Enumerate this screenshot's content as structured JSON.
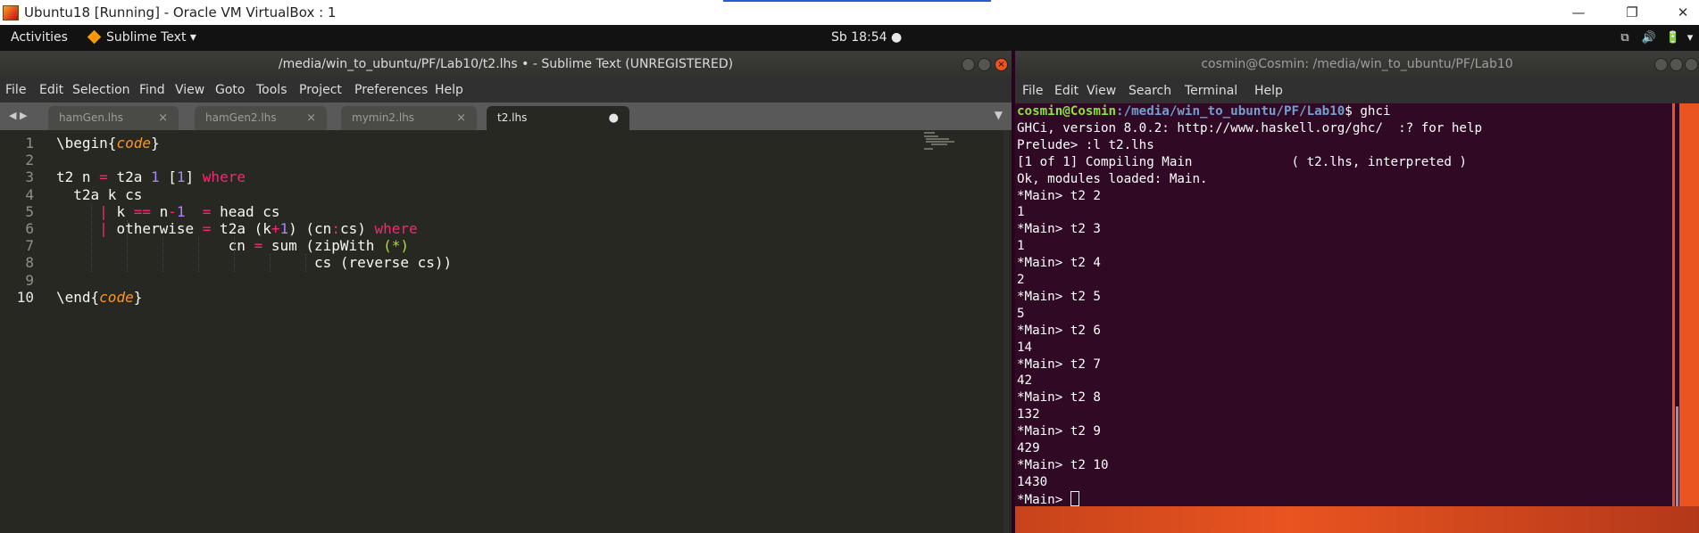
{
  "vm_window": {
    "title": "Ubuntu18 [Running] - Oracle VM VirtualBox : 1",
    "minimize": "—",
    "restore": "❐",
    "close": "✕"
  },
  "topbar": {
    "activities": "Activities",
    "app_name": "Sublime Text",
    "app_caret": "▾",
    "clock": "Sb 18:54 ●",
    "tray": [
      "⧉",
      "🔊",
      "🔋",
      "▾"
    ]
  },
  "sublime": {
    "title": "/media/win_to_ubuntu/PF/Lab10/t2.lhs • - Sublime Text (UNREGISTERED)",
    "menu": [
      "File",
      "Edit",
      "Selection",
      "Find",
      "View",
      "Goto",
      "Tools",
      "Project",
      "Preferences",
      "Help"
    ],
    "tabs": [
      {
        "label": "hamGen.lhs",
        "close": "×"
      },
      {
        "label": "hamGen2.lhs",
        "close": "×"
      },
      {
        "label": "mymin2.lhs",
        "close": "×"
      },
      {
        "label": "t2.lhs",
        "close": "●"
      }
    ],
    "tab_nav": "◀ ▶",
    "tab_dropdown": "▼",
    "line_numbers": [
      "1",
      "2",
      "3",
      "4",
      "5",
      "6",
      "7",
      "8",
      "9",
      "10"
    ],
    "code": [
      [
        {
          "t": "\\begin{",
          "c": ""
        },
        {
          "t": "code",
          "c": "it"
        },
        {
          "t": "}",
          "c": ""
        }
      ],
      [],
      [
        {
          "t": "t2 n ",
          "c": ""
        },
        {
          "t": "=",
          "c": "kw"
        },
        {
          "t": " t2a ",
          "c": ""
        },
        {
          "t": "1",
          "c": "num"
        },
        {
          "t": " [",
          "c": ""
        },
        {
          "t": "1",
          "c": "num"
        },
        {
          "t": "] ",
          "c": ""
        },
        {
          "t": "where",
          "c": "kw"
        }
      ],
      [
        {
          "t": "  t2a k cs",
          "c": ""
        }
      ],
      [
        {
          "t": "     ",
          "c": ""
        },
        {
          "t": "|",
          "c": "kw"
        },
        {
          "t": " k ",
          "c": ""
        },
        {
          "t": "==",
          "c": "kw"
        },
        {
          "t": " n",
          "c": ""
        },
        {
          "t": "-",
          "c": "kw"
        },
        {
          "t": "1",
          "c": "num"
        },
        {
          "t": "  ",
          "c": ""
        },
        {
          "t": "=",
          "c": "kw"
        },
        {
          "t": " head cs",
          "c": ""
        }
      ],
      [
        {
          "t": "     ",
          "c": ""
        },
        {
          "t": "|",
          "c": "kw"
        },
        {
          "t": " otherwise ",
          "c": ""
        },
        {
          "t": "=",
          "c": "kw"
        },
        {
          "t": " t2a (k",
          "c": ""
        },
        {
          "t": "+",
          "c": "kw"
        },
        {
          "t": "1",
          "c": "num"
        },
        {
          "t": ") (cn",
          "c": ""
        },
        {
          "t": ":",
          "c": "kw"
        },
        {
          "t": "cs) ",
          "c": ""
        },
        {
          "t": "where",
          "c": "kw"
        }
      ],
      [
        {
          "t": "                    cn ",
          "c": ""
        },
        {
          "t": "=",
          "c": "kw"
        },
        {
          "t": " sum (zipWith ",
          "c": ""
        },
        {
          "t": "(*)",
          "c": "str"
        }
      ],
      [
        {
          "t": "                              cs (reverse cs))",
          "c": ""
        }
      ],
      [],
      [
        {
          "t": "\\end{",
          "c": ""
        },
        {
          "t": "code",
          "c": "it"
        },
        {
          "t": "}",
          "c": ""
        }
      ]
    ]
  },
  "terminal": {
    "title": "cosmin@Cosmin: /media/win_to_ubuntu/PF/Lab10",
    "menu": [
      "File",
      "Edit",
      "View",
      "Search",
      "Terminal",
      "Help"
    ],
    "prompt_user": "cosmin@Cosmin",
    "prompt_path": ":/media/win_to_ubuntu/PF/Lab10",
    "prompt_cmd": "$ ghci",
    "lines": [
      "GHCi, version 8.0.2: http://www.haskell.org/ghc/  :? for help",
      "Prelude> :l t2.lhs",
      "[1 of 1] Compiling Main             ( t2.lhs, interpreted )",
      "Ok, modules loaded: Main.",
      "*Main> t2 2",
      "1",
      "*Main> t2 3",
      "1",
      "*Main> t2 4",
      "2",
      "*Main> t2 5",
      "5",
      "*Main> t2 6",
      "14",
      "*Main> t2 7",
      "42",
      "*Main> t2 8",
      "132",
      "*Main> t2 9",
      "429",
      "*Main> t2 10",
      "1430"
    ],
    "last_prompt": "*Main> "
  }
}
